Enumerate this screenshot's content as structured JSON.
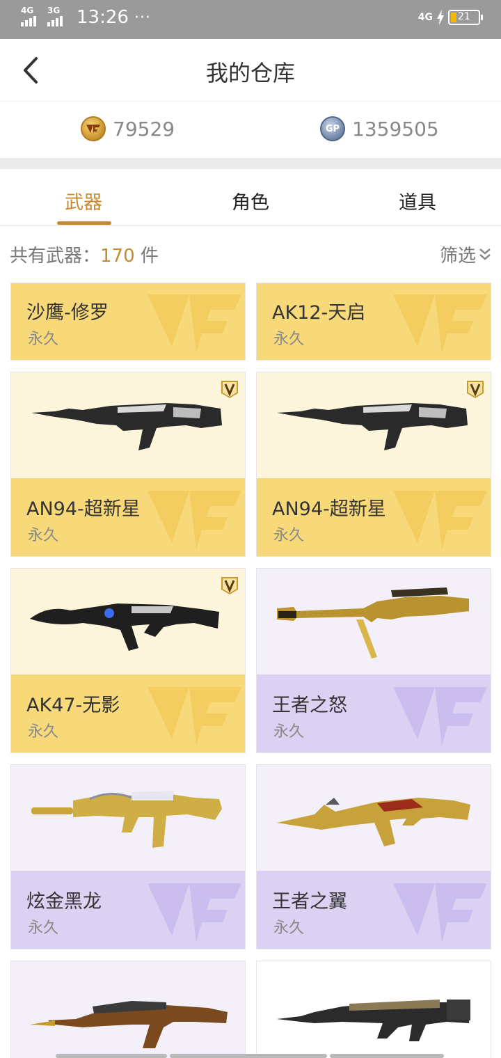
{
  "status_bar": {
    "sim1": "4G",
    "sim2": "3G",
    "time": "13:26",
    "dots": "···",
    "net": "4G",
    "battery": "21"
  },
  "nav": {
    "title": "我的仓库"
  },
  "currency": {
    "cf_points": "79529",
    "gp_points": "1359505",
    "gp_icon": "GP"
  },
  "tabs": [
    {
      "label": "武器"
    },
    {
      "label": "角色"
    },
    {
      "label": "道具"
    }
  ],
  "count": {
    "prefix": "共有武器：",
    "number": "170",
    "suffix": " 件"
  },
  "filter": {
    "label": "筛选"
  },
  "items": [
    {
      "name": "沙鹰-修罗",
      "duration": "永久",
      "theme": "gold"
    },
    {
      "name": "AK12-天启",
      "duration": "永久",
      "theme": "gold"
    },
    {
      "name": "AN94-超新星",
      "duration": "永久",
      "theme": "gold"
    },
    {
      "name": "AN94-超新星",
      "duration": "永久",
      "theme": "gold"
    },
    {
      "name": "AK47-无影",
      "duration": "永久",
      "theme": "gold"
    },
    {
      "name": "王者之怒",
      "duration": "永久",
      "theme": "purple"
    },
    {
      "name": "炫金黑龙",
      "duration": "永久",
      "theme": "purple"
    },
    {
      "name": "王者之翼",
      "duration": "永久",
      "theme": "purple"
    }
  ],
  "colors": {
    "accent": "#c88a2e",
    "gold_card": "#f8d97a",
    "purple_card": "#dbd1f3"
  }
}
